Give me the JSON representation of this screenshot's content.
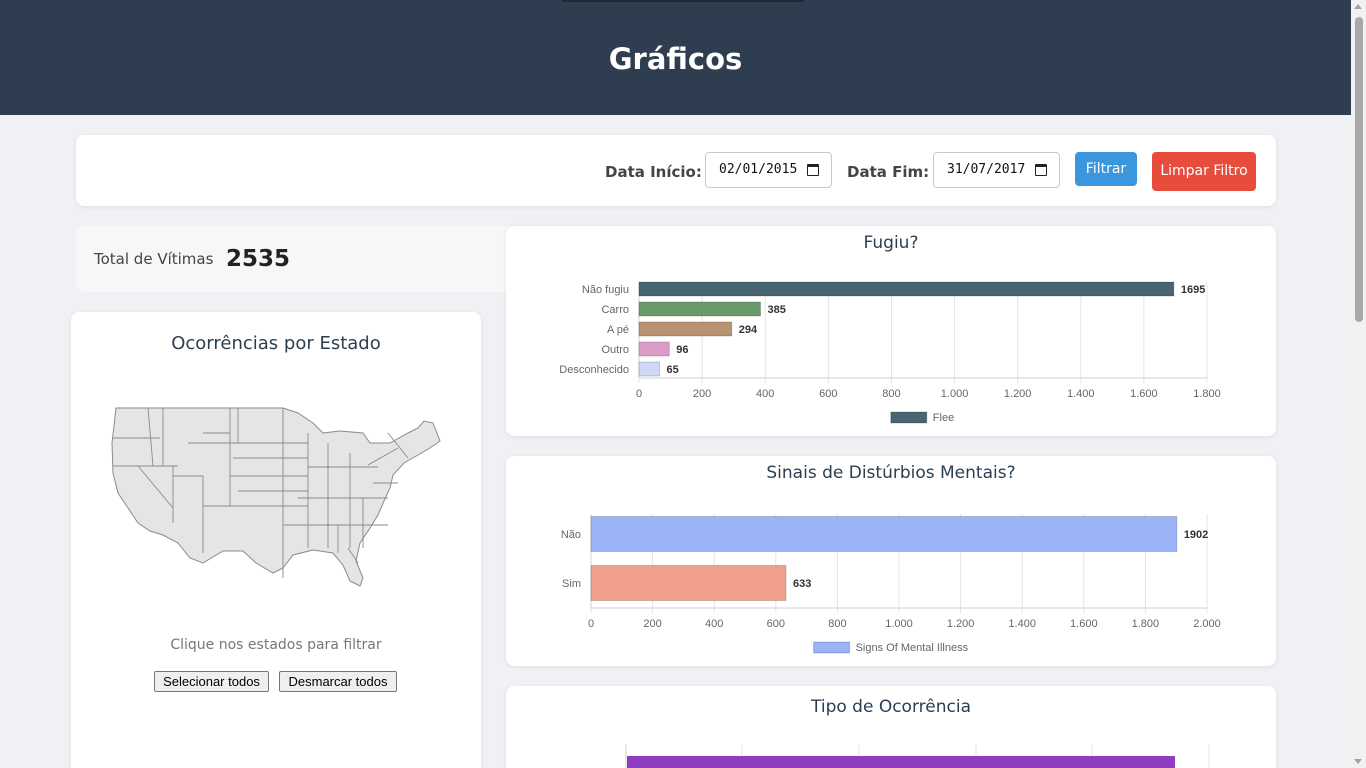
{
  "header": {
    "title": "Gráficos"
  },
  "filters": {
    "start_label": "Data Início:",
    "start_value": "02/01/2015",
    "end_label": "Data Fim:",
    "end_value": "31/07/2017",
    "filter_button": "Filtrar",
    "clear_button": "Limpar Filtro"
  },
  "summary": {
    "total_label": "Total de Vítimas",
    "total_value": "2535"
  },
  "map": {
    "title": "Ocorrências por Estado",
    "hint": "Clique nos estados para filtrar",
    "select_all": "Selecionar todos",
    "deselect_all": "Desmarcar todos"
  },
  "chart_data": [
    {
      "type": "bar",
      "orientation": "horizontal",
      "title": "Fugiu?",
      "categories": [
        "Não fugiu",
        "Carro",
        "A pé",
        "Outro",
        "Desconhecido"
      ],
      "values": [
        1695,
        385,
        294,
        96,
        65
      ],
      "colors": [
        "#4a6572",
        "#6a9a6a",
        "#b89372",
        "#dc9cc8",
        "#d0d8f8"
      ],
      "xlim": [
        0,
        1800
      ],
      "ticks": [
        0,
        200,
        400,
        600,
        800,
        1000,
        1200,
        1400,
        1600,
        1800
      ],
      "tick_labels": [
        "0",
        "200",
        "400",
        "600",
        "800",
        "1.000",
        "1.200",
        "1.400",
        "1.600",
        "1.800"
      ],
      "series": [
        {
          "name": "Flee",
          "color": "#4a6572"
        }
      ],
      "legend": "bottom"
    },
    {
      "type": "bar",
      "orientation": "horizontal",
      "title": "Sinais de Distúrbios Mentais?",
      "categories": [
        "Não",
        "Sim"
      ],
      "values": [
        1902,
        633
      ],
      "colors": [
        "#9ab4f7",
        "#f0a08a"
      ],
      "xlim": [
        0,
        2000
      ],
      "ticks": [
        0,
        200,
        400,
        600,
        800,
        1000,
        1200,
        1400,
        1600,
        1800,
        2000
      ],
      "tick_labels": [
        "0",
        "200",
        "400",
        "600",
        "800",
        "1.000",
        "1.200",
        "1.400",
        "1.600",
        "1.800",
        "2.000"
      ],
      "series": [
        {
          "name": "Signs Of Mental Illness",
          "color": "#9ab4f7"
        }
      ],
      "legend": "bottom"
    },
    {
      "type": "bar",
      "orientation": "horizontal",
      "title": "Tipo de Ocorrência",
      "colors": [
        "#8e3cc0"
      ],
      "legend": "bottom"
    }
  ]
}
